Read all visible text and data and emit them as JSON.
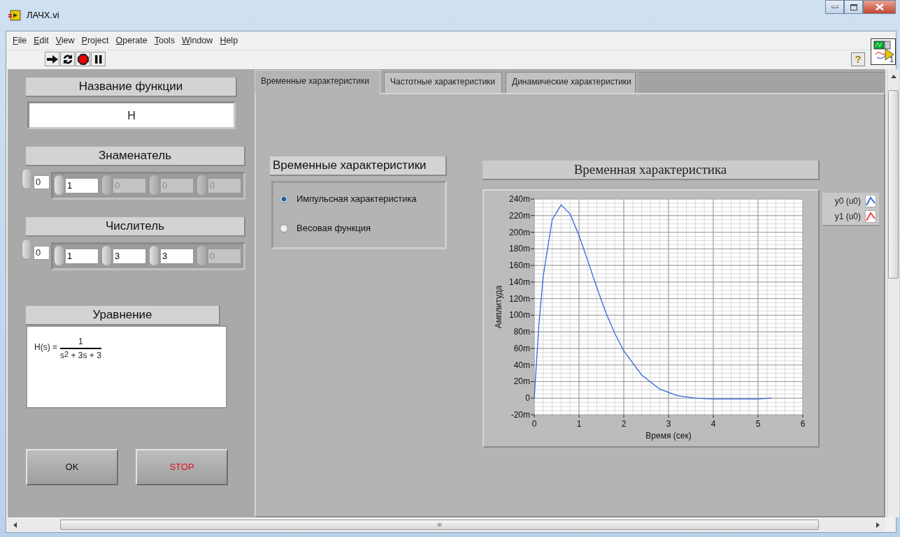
{
  "window": {
    "title": "ЛАЧХ.vi"
  },
  "menu": [
    "File",
    "Edit",
    "View",
    "Project",
    "Operate",
    "Tools",
    "Window",
    "Help"
  ],
  "toolbar": [
    {
      "kind": "run"
    },
    {
      "kind": "run_continuous"
    },
    {
      "kind": "abort"
    },
    {
      "kind": "pause"
    }
  ],
  "help_button": "?",
  "vi_icon_number": "1",
  "left_panel": {
    "function_name": {
      "label": "Название функции",
      "value": "H"
    },
    "denominator": {
      "label": "Знаменатель",
      "index": "0",
      "elements": [
        {
          "value": "1",
          "disabled": false
        },
        {
          "value": "0",
          "disabled": true
        },
        {
          "value": "0",
          "disabled": true
        },
        {
          "value": "0",
          "disabled": true
        }
      ]
    },
    "numerator": {
      "label": "Числитель",
      "index": "0",
      "elements": [
        {
          "value": "1",
          "disabled": false
        },
        {
          "value": "3",
          "disabled": false
        },
        {
          "value": "3",
          "disabled": false
        },
        {
          "value": "0",
          "disabled": true
        }
      ]
    },
    "equation": {
      "label": "Уравнение",
      "lhs": "H(s) =",
      "numerator": "1",
      "denominator": "s$^{2}$ + 3s + 3"
    },
    "buttons": [
      {
        "label": "OK",
        "kind": "ok"
      },
      {
        "label": "STOP",
        "kind": "stop"
      }
    ]
  },
  "tabs": [
    {
      "label": "Временные характеристики",
      "selected": true
    },
    {
      "label": "Частотные характеристики",
      "selected": false
    },
    {
      "label": "Динамические характеристики",
      "selected": false
    }
  ],
  "radio_group": {
    "label": "Временные характеристики",
    "options": [
      {
        "label": "Импульсная характеристика",
        "selected": true
      },
      {
        "label": "Весовая функция",
        "selected": false
      }
    ]
  },
  "graph": {
    "title": "Временная характеристика",
    "legend": [
      {
        "label": "y0 (u0)",
        "color": "#3366dd"
      },
      {
        "label": "y1 (u0)",
        "color": "#ee4444"
      }
    ],
    "chart_data": {
      "type": "line",
      "xlabel": "Время (сек)",
      "ylabel": "Амплитуда",
      "x": [
        0,
        0.1,
        0.2,
        0.4,
        0.6,
        0.8,
        1.0,
        1.2,
        1.4,
        1.6,
        1.8,
        2.0,
        2.4,
        2.8,
        3.2,
        3.6,
        4.0,
        4.5,
        5.0,
        5.3
      ],
      "series": [
        {
          "color": "#3366dd",
          "values": [
            0,
            86,
            147,
            215,
            233,
            222,
            196,
            165,
            133,
            103,
            78,
            57,
            28,
            11,
            3,
            0,
            -1,
            -1,
            -1,
            0
          ]
        }
      ],
      "xlim": [
        0,
        6
      ],
      "ylim": [
        -20,
        240
      ],
      "grid": true,
      "xticks": [
        0,
        1,
        2,
        3,
        4,
        5,
        6
      ],
      "yticks": [
        {
          "value": -20,
          "label": "-20m"
        },
        {
          "value": 0,
          "label": "0"
        },
        {
          "value": 20,
          "label": "20m"
        },
        {
          "value": 40,
          "label": "40m"
        },
        {
          "value": 60,
          "label": "60m"
        },
        {
          "value": 80,
          "label": "80m"
        },
        {
          "value": 100,
          "label": "100m"
        },
        {
          "value": 120,
          "label": "120m"
        },
        {
          "value": 140,
          "label": "140m"
        },
        {
          "value": 160,
          "label": "160m"
        },
        {
          "value": 180,
          "label": "180m"
        },
        {
          "value": 200,
          "label": "200m"
        },
        {
          "value": 220,
          "label": "220m"
        },
        {
          "value": 240,
          "label": "240m"
        }
      ]
    }
  },
  "scrollbar_label": "III"
}
